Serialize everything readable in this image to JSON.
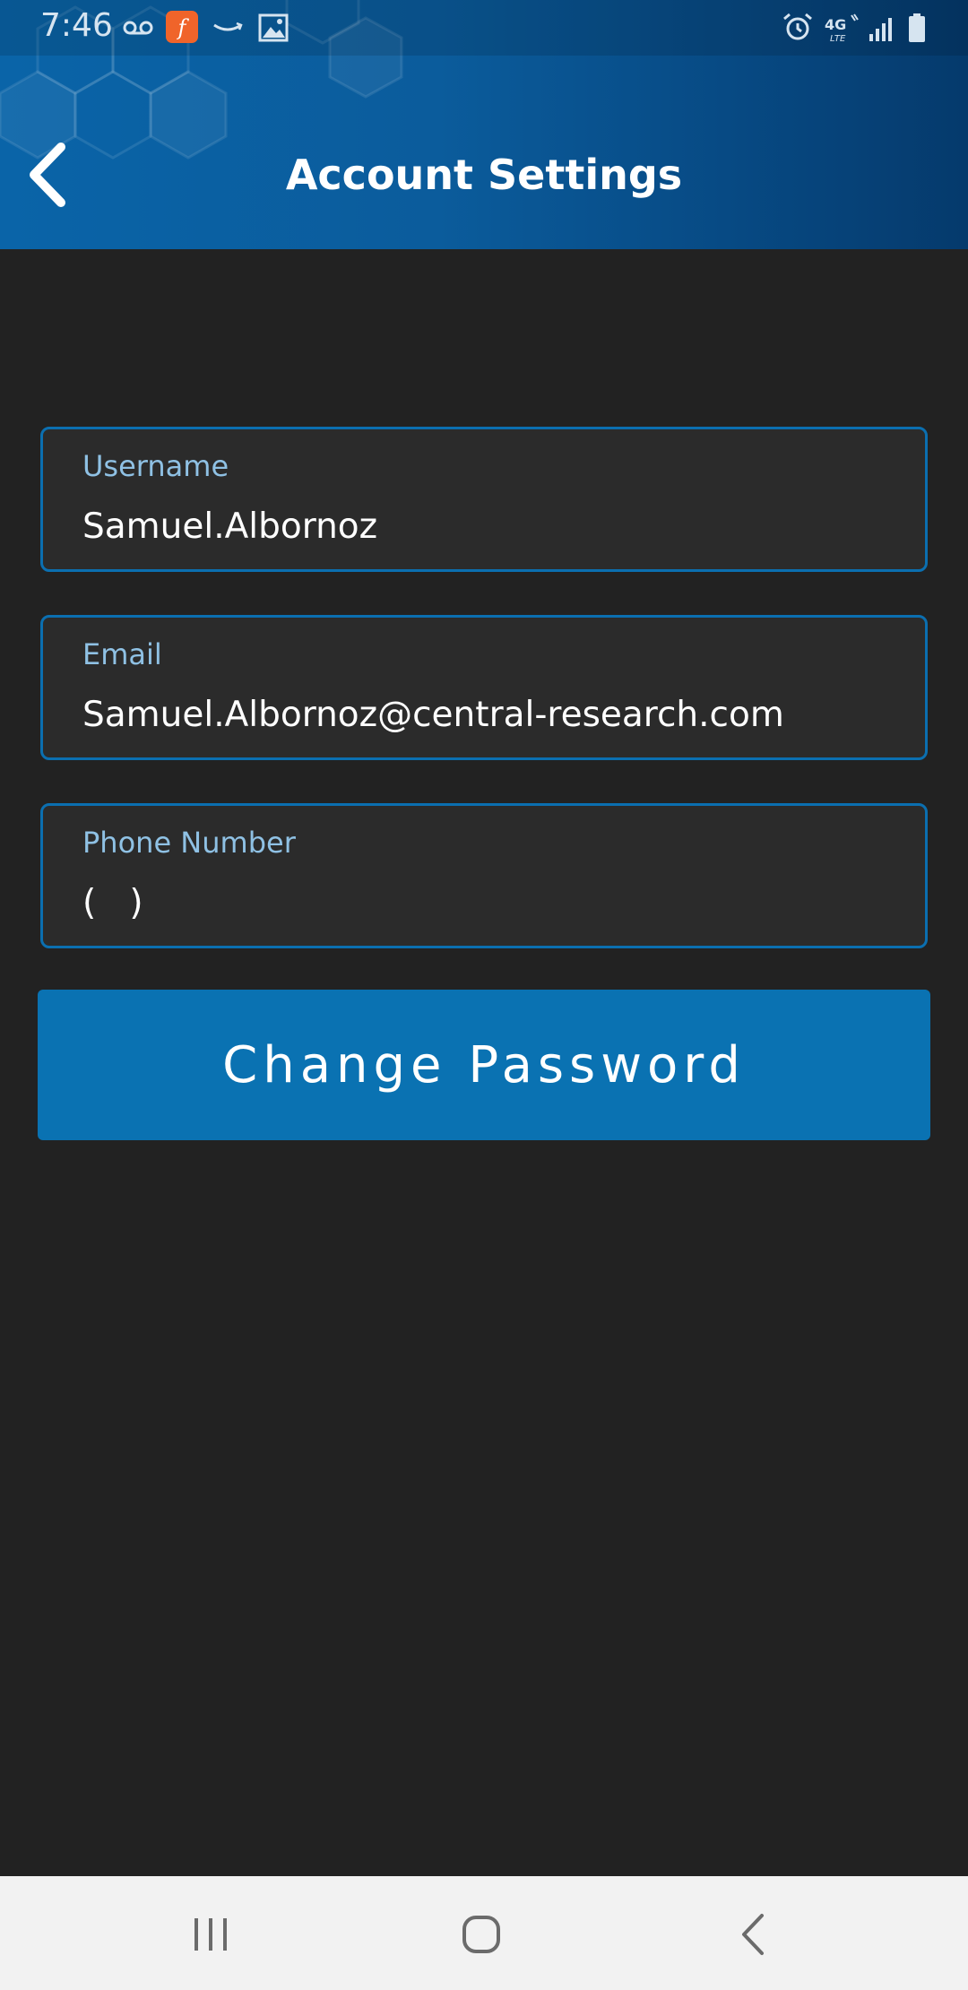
{
  "status_bar": {
    "time": "7:46",
    "left_icons": [
      "voicemail-icon",
      "flash-app-icon",
      "amazon-icon",
      "gallery-icon"
    ],
    "right_icons": [
      "alarm-icon",
      "4g-lte-icon",
      "signal-icon",
      "battery-icon"
    ]
  },
  "header": {
    "title": "Account Settings"
  },
  "form": {
    "username": {
      "label": "Username",
      "value": "Samuel.Albornoz"
    },
    "email": {
      "label": "Email",
      "value": "Samuel.Albornoz@central-research.com"
    },
    "phone": {
      "label": "Phone Number",
      "value": "(   )"
    }
  },
  "actions": {
    "change_password_label": "Change Password"
  },
  "colors": {
    "header_blue": "#0a64a8",
    "accent_blue": "#0a72b2",
    "background": "#222222",
    "label_blue": "#8fc1e4"
  },
  "nav_bar": {
    "items": [
      "recent-apps-icon",
      "home-icon",
      "back-nav-icon"
    ]
  }
}
